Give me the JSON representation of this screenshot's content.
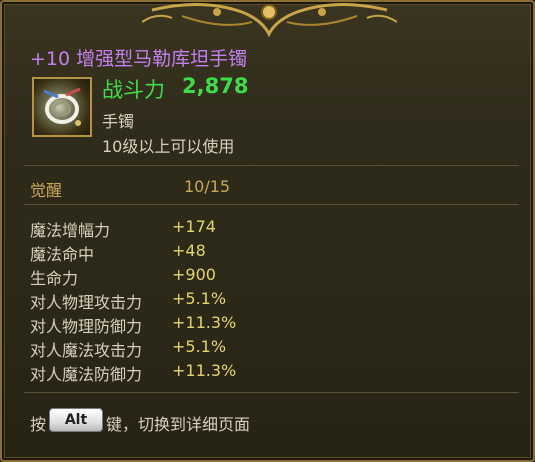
{
  "item": {
    "title": "+10 增强型马勒库坦手镯",
    "combat_label": "战斗力",
    "combat_value": "2,878",
    "type": "手镯",
    "level_requirement": "10级以上可以使用"
  },
  "awaken": {
    "label": "觉醒",
    "value": "10/15"
  },
  "stats": [
    {
      "name": "魔法增幅力",
      "value": "+174"
    },
    {
      "name": "魔法命中",
      "value": "+48"
    },
    {
      "name": "生命力",
      "value": "+900"
    },
    {
      "name": "对人物理攻击力",
      "value": "+5.1%"
    },
    {
      "name": "对人物理防御力",
      "value": "+11.3%"
    },
    {
      "name": "对人魔法攻击力",
      "value": "+5.1%"
    },
    {
      "name": "对人魔法防御力",
      "value": "+11.3%"
    }
  ],
  "hint": {
    "prefix": "按",
    "key": "Alt",
    "suffix": "键，切换到详细页面"
  },
  "colors": {
    "title": "#c47ff0",
    "combat": "#3fdc4a",
    "stat_value": "#e3d56a",
    "awaken": "#c7a857",
    "frame_gold": "#8a6e33"
  },
  "icons": {
    "item": "bracelet-icon",
    "ornament": "gold-ornament"
  }
}
